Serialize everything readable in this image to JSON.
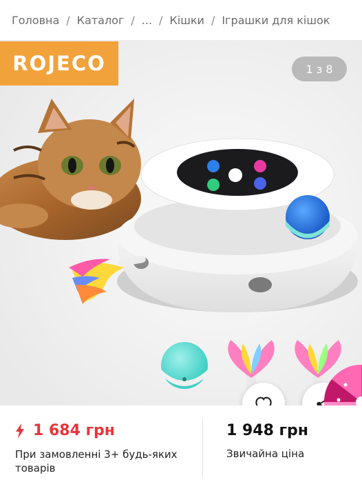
{
  "breadcrumb": {
    "items": [
      "Головна",
      "Каталог",
      "...",
      "Кішки",
      "Іграшки для кішок"
    ],
    "separator": "/"
  },
  "gallery": {
    "brand_logo_text": "ROJECO",
    "image_counter": "1 з 8",
    "brand_color": "#f2a23a"
  },
  "pricing": {
    "promo_price": "1 684 грн",
    "promo_note": "При замовленні 3+ будь-яких товарів",
    "regular_price": "1 948 грн",
    "regular_note": "Звичайна ціна",
    "promo_color": "#e8353b"
  },
  "actions": {
    "favorite_icon": "heart-icon",
    "share_icon": "share-icon"
  }
}
